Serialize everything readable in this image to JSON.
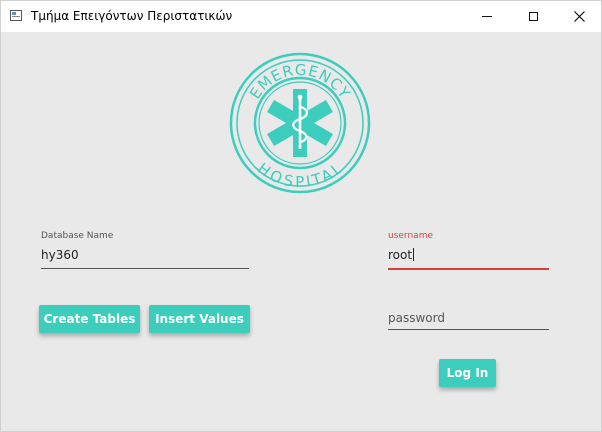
{
  "window": {
    "title": "Τμήμα Επειγόντων Περιστατικών",
    "controls": {
      "minimize": "minimize-icon",
      "maximize": "maximize-icon",
      "close": "close-icon"
    }
  },
  "logo": {
    "top_text": "EMERGENCY",
    "bottom_text": "HOSPITAL",
    "icon": "star-of-life-icon",
    "color": "#3ccdbd"
  },
  "form": {
    "database": {
      "label": "Database Name",
      "value": "hy360"
    },
    "username": {
      "label": "username",
      "value": "root"
    },
    "password": {
      "placeholder": "password"
    }
  },
  "buttons": {
    "create_tables": "Create Tables",
    "insert_values": "Insert Values",
    "login": "Log In"
  },
  "colors": {
    "accent": "#3ccdbd",
    "focus": "#d6403a",
    "background": "#e9e9e9"
  }
}
